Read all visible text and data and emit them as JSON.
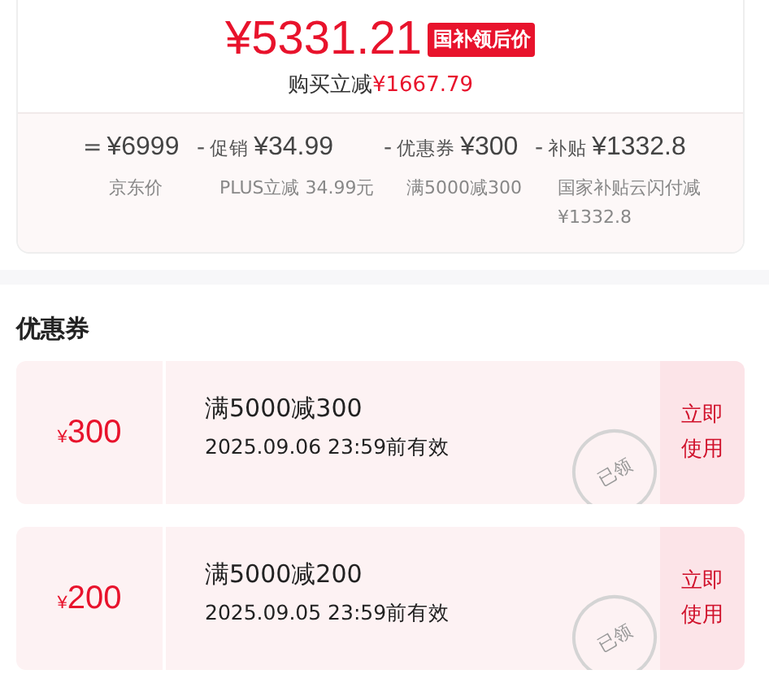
{
  "price": {
    "amount": "¥5331.21",
    "tag": "国补领后价",
    "saving_label": "购买立减",
    "saving_amount": "¥1667.79"
  },
  "breakdown": [
    {
      "sign": "=",
      "value": "¥6999",
      "note": "京东价"
    },
    {
      "sign": "-",
      "label": "促销",
      "value": "¥34.99",
      "note": "PLUS立减 34.99元"
    },
    {
      "sign": "-",
      "label": "优惠券",
      "value": "¥300",
      "note": "满5000减300"
    },
    {
      "sign": "-",
      "label": "补贴",
      "value": "¥1332.8",
      "note": "国家补贴云闪付减¥1332.8"
    }
  ],
  "coupons_title": "优惠券",
  "coupons": [
    {
      "currency": "¥",
      "amount": "300",
      "condition": "满5000减300",
      "validity": "2025.09.06 23:59前有效",
      "stamp": "已领",
      "action": "立即使用"
    },
    {
      "currency": "¥",
      "amount": "200",
      "condition": "满5000减200",
      "validity": "2025.09.05 23:59前有效",
      "stamp": "已领",
      "action": "立即使用"
    }
  ]
}
